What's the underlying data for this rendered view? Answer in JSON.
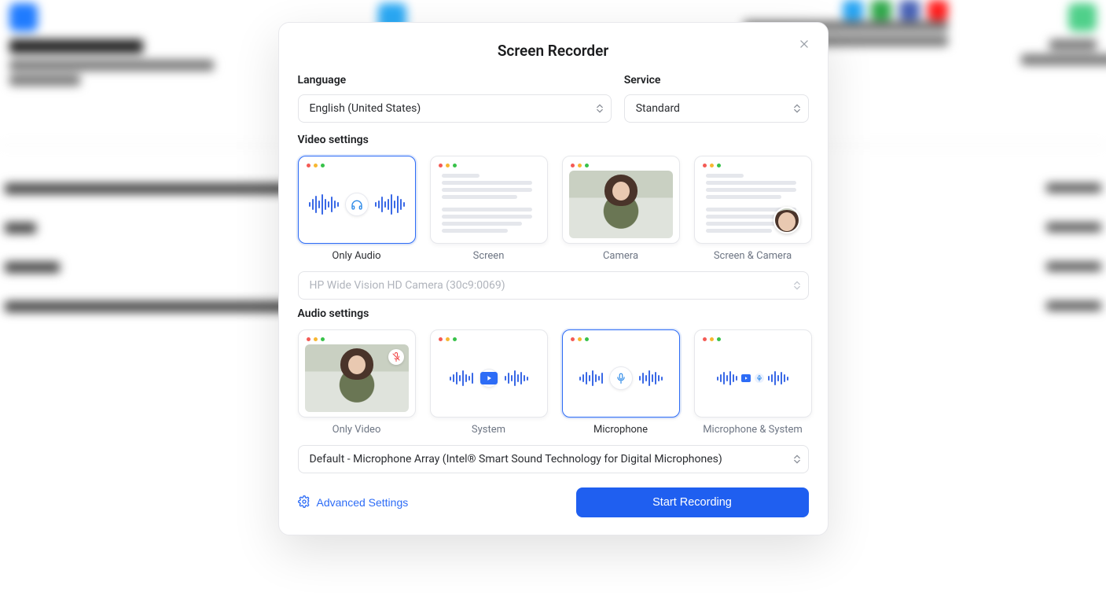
{
  "modal": {
    "title": "Screen Recorder",
    "language_label": "Language",
    "service_label": "Service",
    "language_value": "English (United States)",
    "service_value": "Standard",
    "video_settings_label": "Video settings",
    "video_options": {
      "only_audio": "Only Audio",
      "screen": "Screen",
      "camera": "Camera",
      "screen_camera": "Screen & Camera"
    },
    "video_selected": "only_audio",
    "camera_device": "HP Wide Vision HD Camera (30c9:0069)",
    "audio_settings_label": "Audio settings",
    "audio_options": {
      "only_video": "Only Video",
      "system": "System",
      "microphone": "Microphone",
      "microphone_system": "Microphone & System"
    },
    "audio_selected": "microphone",
    "mic_device": "Default - Microphone Array (Intel® Smart Sound Technology for Digital Microphones)",
    "advanced_label": "Advanced Settings",
    "start_label": "Start Recording"
  }
}
